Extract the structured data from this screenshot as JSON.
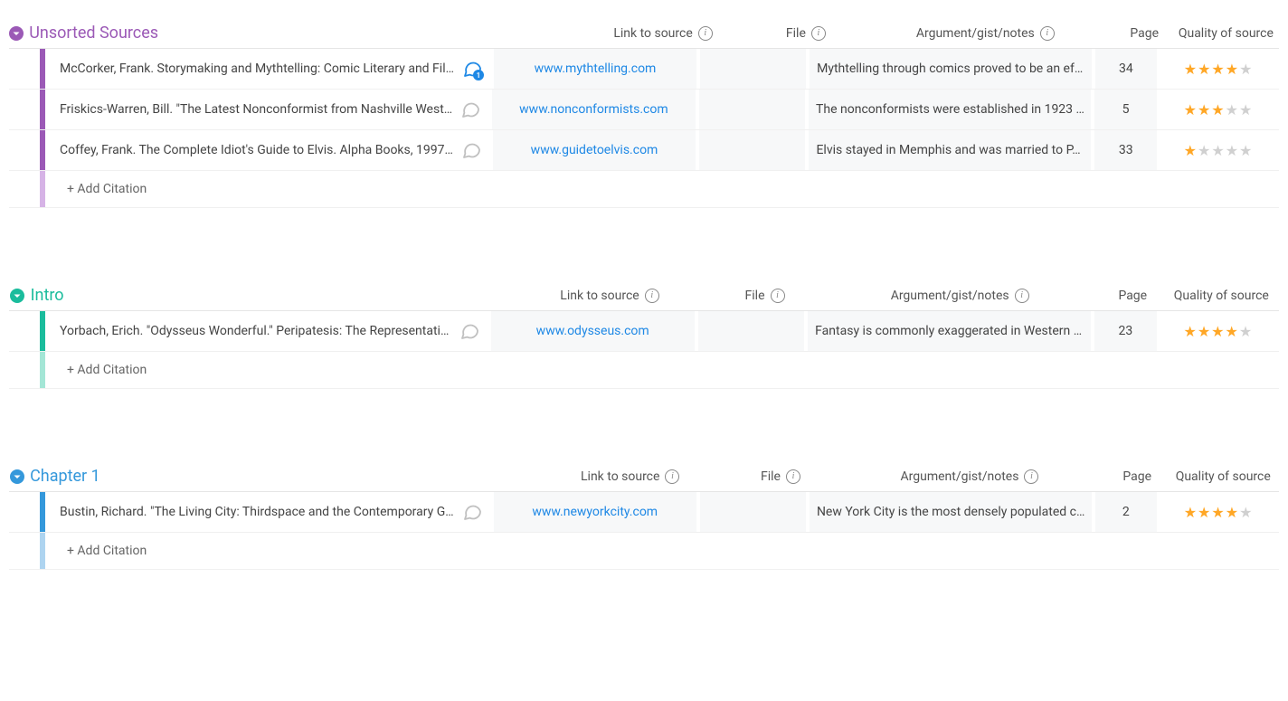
{
  "columns": {
    "link": "Link to source",
    "file": "File",
    "argument": "Argument/gist/notes",
    "page": "Page",
    "quality": "Quality of source"
  },
  "add_citation_label": "+ Add Citation",
  "sections": [
    {
      "id": "unsorted",
      "title": "Unsorted Sources",
      "chevron_color": "#9b59b6",
      "title_color": "#9b59b6",
      "bar_color": "#9b59b6",
      "bar_light": "#d6b3e6",
      "rows": [
        {
          "citation": "McCorker, Frank. Storymaking and Mythtelling: Comic Literary and Fil…",
          "link": "www.mythtelling.com",
          "file": "",
          "argument": "Mythtelling through comics proved to be an ef…",
          "page": "34",
          "stars": 4,
          "has_comment_badge": true,
          "comment_count": "1",
          "comment_active": true
        },
        {
          "citation": "Friskics-Warren, Bill. \"The Latest Nonconformist from Nashville West…",
          "link": "www.nonconformists.com",
          "file": "",
          "argument": "The nonconformists were established in 1923 …",
          "page": "5",
          "stars": 3,
          "has_comment_badge": false,
          "comment_active": false
        },
        {
          "citation": "Coffey, Frank. The Complete Idiot's Guide to Elvis. Alpha Books, 1997…",
          "link": "www.guidetoelvis.com",
          "file": "",
          "argument": "Elvis stayed in Memphis and was married to P…",
          "page": "33",
          "stars": 1,
          "has_comment_badge": false,
          "comment_active": false
        }
      ]
    },
    {
      "id": "intro",
      "title": "Intro",
      "chevron_color": "#1abc9c",
      "title_color": "#1abc9c",
      "bar_color": "#1abc9c",
      "bar_light": "#a4e6d6",
      "rows": [
        {
          "citation": "Yorbach, Erich. \"Odysseus Wonderful.\" Peripatesis: The Representati…",
          "link": "www.odysseus.com",
          "file": "",
          "argument": "Fantasy is commonly exaggerated in Western …",
          "page": "23",
          "stars": 4,
          "has_comment_badge": false,
          "comment_active": false
        }
      ]
    },
    {
      "id": "chapter1",
      "title": "Chapter 1",
      "chevron_color": "#3498db",
      "title_color": "#3498db",
      "bar_color": "#3498db",
      "bar_light": "#aed4f0",
      "rows": [
        {
          "citation": "Bustin, Richard. \"The Living City: Thirdspace and the Contemporary G…",
          "link": "www.newyorkcity.com",
          "file": "",
          "argument": "New York City is the most densely populated c…",
          "page": "2",
          "stars": 4,
          "has_comment_badge": false,
          "comment_active": false
        }
      ]
    }
  ]
}
